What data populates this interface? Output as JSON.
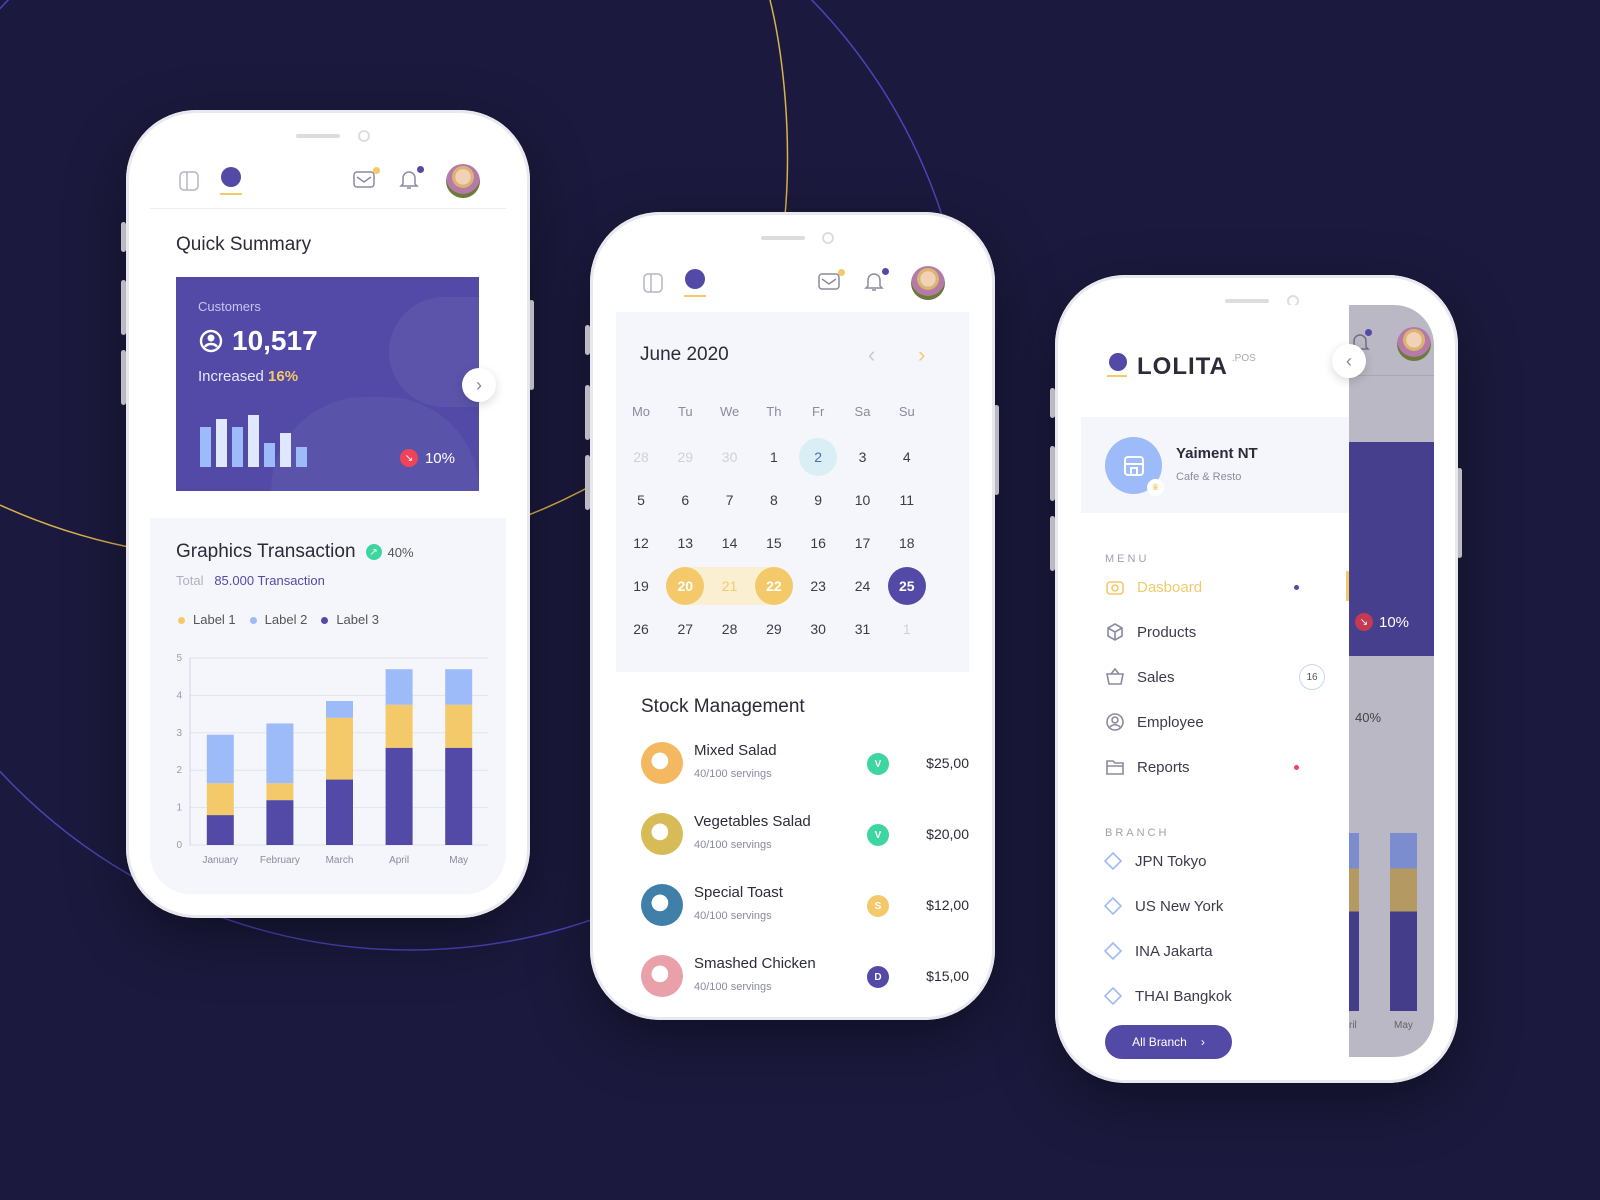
{
  "colors": {
    "background": "#1b1a3e",
    "primary": "#524aa6",
    "accent": "#f4c96a",
    "light_blue": "#9dbaf9",
    "green": "#3dd6a0",
    "red": "#f0435a"
  },
  "phone1": {
    "quick_summary_title": "Quick Summary",
    "card": {
      "label": "Customers",
      "value": "10,517",
      "increased_prefix": "Increased",
      "increased_value": "16%",
      "change": "10%",
      "mini_bars": [
        0.5,
        0.6,
        0.5,
        0.65,
        0.3,
        0.42,
        0.25
      ]
    },
    "graphics": {
      "title": "Graphics Transaction",
      "change": "40%",
      "total_label": "Total",
      "total_value": "85.000 Transaction"
    },
    "legend": [
      "Label 1",
      "Label 2",
      "Label 3"
    ]
  },
  "chart_data": {
    "type": "bar",
    "stacked": true,
    "categories": [
      "January",
      "February",
      "March",
      "April",
      "May"
    ],
    "series": [
      {
        "name": "Label 3",
        "color": "#524aa6",
        "values": [
          0.8,
          1.2,
          1.75,
          2.6,
          2.6
        ]
      },
      {
        "name": "Label 1",
        "color": "#f4c96a",
        "values": [
          0.85,
          0.45,
          1.65,
          1.15,
          1.15
        ]
      },
      {
        "name": "Label 2",
        "color": "#9dbaf9",
        "values": [
          1.3,
          1.6,
          0.45,
          0.95,
          0.95
        ]
      }
    ],
    "ylim": [
      0,
      5
    ],
    "yticks": [
      "0",
      "1",
      "2",
      "3",
      "4",
      "5"
    ],
    "grid": true,
    "legend": "top-left"
  },
  "phone2": {
    "month": "June 2020",
    "weekdays": [
      "Mo",
      "Tu",
      "We",
      "Th",
      "Fr",
      "Sa",
      "Su"
    ],
    "weeks": [
      [
        "28",
        "29",
        "30",
        "1",
        "2",
        "3",
        "4"
      ],
      [
        "5",
        "6",
        "7",
        "8",
        "9",
        "10",
        "11"
      ],
      [
        "12",
        "13",
        "14",
        "15",
        "16",
        "17",
        "18"
      ],
      [
        "19",
        "20",
        "21",
        "22",
        "23",
        "24",
        "25"
      ],
      [
        "26",
        "27",
        "28",
        "29",
        "30",
        "31",
        "1"
      ]
    ],
    "today": "2",
    "range": [
      "20",
      "21",
      "22"
    ],
    "selected": "25",
    "stock_title": "Stock Management",
    "stock": [
      {
        "name": "Mixed Salad",
        "servings": "40/100 servings",
        "badge": "V",
        "badge_color": "#3dd6a0",
        "price": "$25,00",
        "thumb": "#f4b860"
      },
      {
        "name": "Vegetables Salad",
        "servings": "40/100 servings",
        "badge": "V",
        "badge_color": "#3dd6a0",
        "price": "$20,00",
        "thumb": "#d6bb57"
      },
      {
        "name": "Special Toast",
        "servings": "40/100 servings",
        "badge": "S",
        "badge_color": "#f4c96a",
        "price": "$12,00",
        "thumb": "#3f7fa8"
      },
      {
        "name": "Smashed Chicken",
        "servings": "40/100 servings",
        "badge": "D",
        "badge_color": "#524aa6",
        "price": "$15,00",
        "thumb": "#e9a0a8"
      }
    ]
  },
  "phone3": {
    "logo": "LOLITA",
    "logo_suffix": ".POS",
    "store_name": "Yaiment NT",
    "store_type": "Cafe & Resto",
    "menu_heading": "MENU",
    "menu": [
      {
        "label": "Dasboard",
        "icon": "dashboard-icon",
        "active": true
      },
      {
        "label": "Products",
        "icon": "box-icon"
      },
      {
        "label": "Sales",
        "icon": "basket-icon",
        "count": "16"
      },
      {
        "label": "Employee",
        "icon": "user-icon"
      },
      {
        "label": "Reports",
        "icon": "folder-icon",
        "alert": true
      }
    ],
    "branch_heading": "BRANCH",
    "branches": [
      "JPN Tokyo",
      "US New York",
      "INA Jakarta",
      "THAI Bangkok"
    ],
    "all_branch": "All Branch",
    "behind": {
      "change": "10%",
      "growth": "40%",
      "x_labels": [
        "ril",
        "May"
      ]
    }
  }
}
